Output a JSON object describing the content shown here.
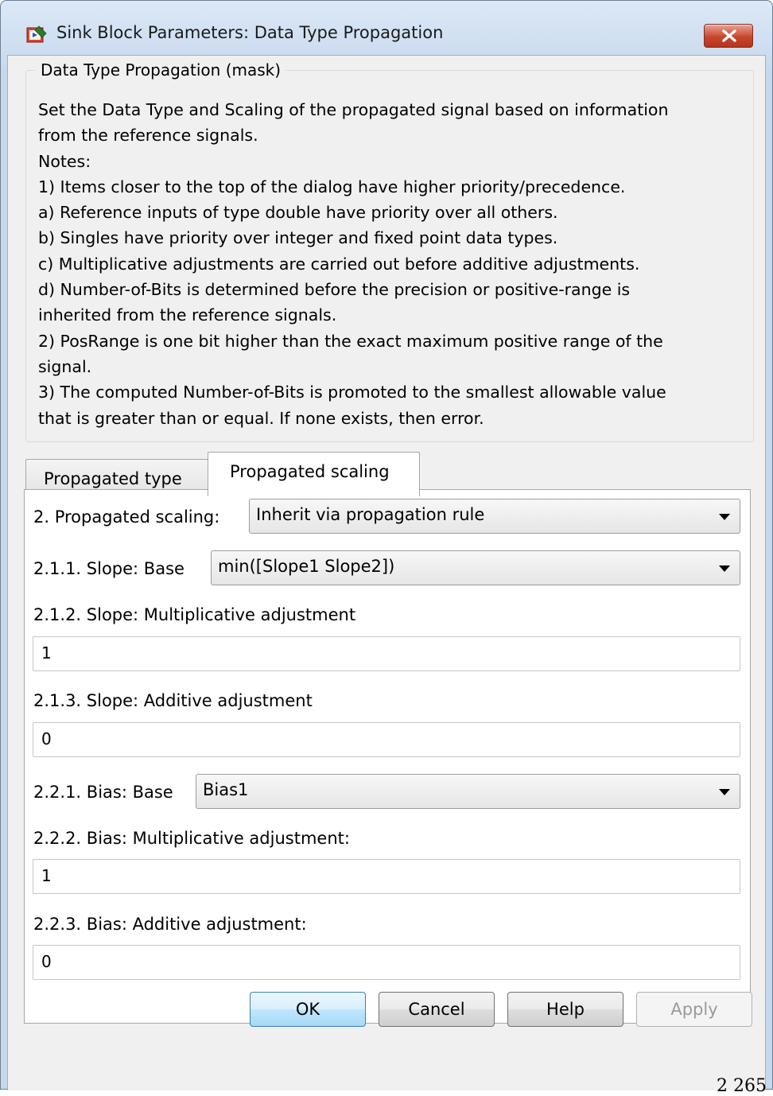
{
  "window": {
    "title": "Sink Block Parameters: Data Type Propagation"
  },
  "mask": {
    "legend": "Data Type Propagation (mask)",
    "description_lines": [
      "Set the Data Type and Scaling of the propagated signal based on information",
      "from the reference signals.",
      "Notes:",
      "1) Items closer to the top of the dialog have higher priority/precedence.",
      "a) Reference inputs of type double have priority over all others.",
      "b) Singles have priority over integer and fixed point data types.",
      "c) Multiplicative adjustments are carried out before additive adjustments.",
      "d) Number-of-Bits is determined before the precision or positive-range is",
      "inherited from the reference signals.",
      "2) PosRange is one bit higher than the exact maximum positive range of the",
      "signal.",
      "3) The computed Number-of-Bits is promoted to the smallest allowable value",
      "that is greater than or equal.  If none exists, then error."
    ]
  },
  "tabs": {
    "propagated_type": "Propagated type",
    "propagated_scaling": "Propagated scaling"
  },
  "params": {
    "propagated_scaling_label": "2. Propagated scaling:",
    "propagated_scaling_value": "Inherit via propagation rule",
    "slope_base_label": "2.1.1. Slope: Base",
    "slope_base_value": "min([Slope1 Slope2])",
    "slope_mult_label": "2.1.2. Slope: Multiplicative adjustment",
    "slope_mult_value": "1",
    "slope_add_label": "2.1.3. Slope: Additive adjustment",
    "slope_add_value": "0",
    "bias_base_label": "2.2.1. Bias: Base",
    "bias_base_value": "Bias1",
    "bias_mult_label": "2.2.2. Bias: Multiplicative adjustment:",
    "bias_mult_value": "1",
    "bias_add_label": "2.2.3. Bias: Additive adjustment:",
    "bias_add_value": "0"
  },
  "buttons": {
    "ok": "OK",
    "cancel": "Cancel",
    "help": "Help",
    "apply": "Apply"
  },
  "footer_fragment": "2 265",
  "icons": {
    "app": "simulink-block-icon",
    "close": "close-icon",
    "dropdown": "chevron-down-icon"
  },
  "colors": {
    "title_bar": "#c9daee",
    "close_button": "#c8462f",
    "default_button_border": "#3c7fb1"
  }
}
